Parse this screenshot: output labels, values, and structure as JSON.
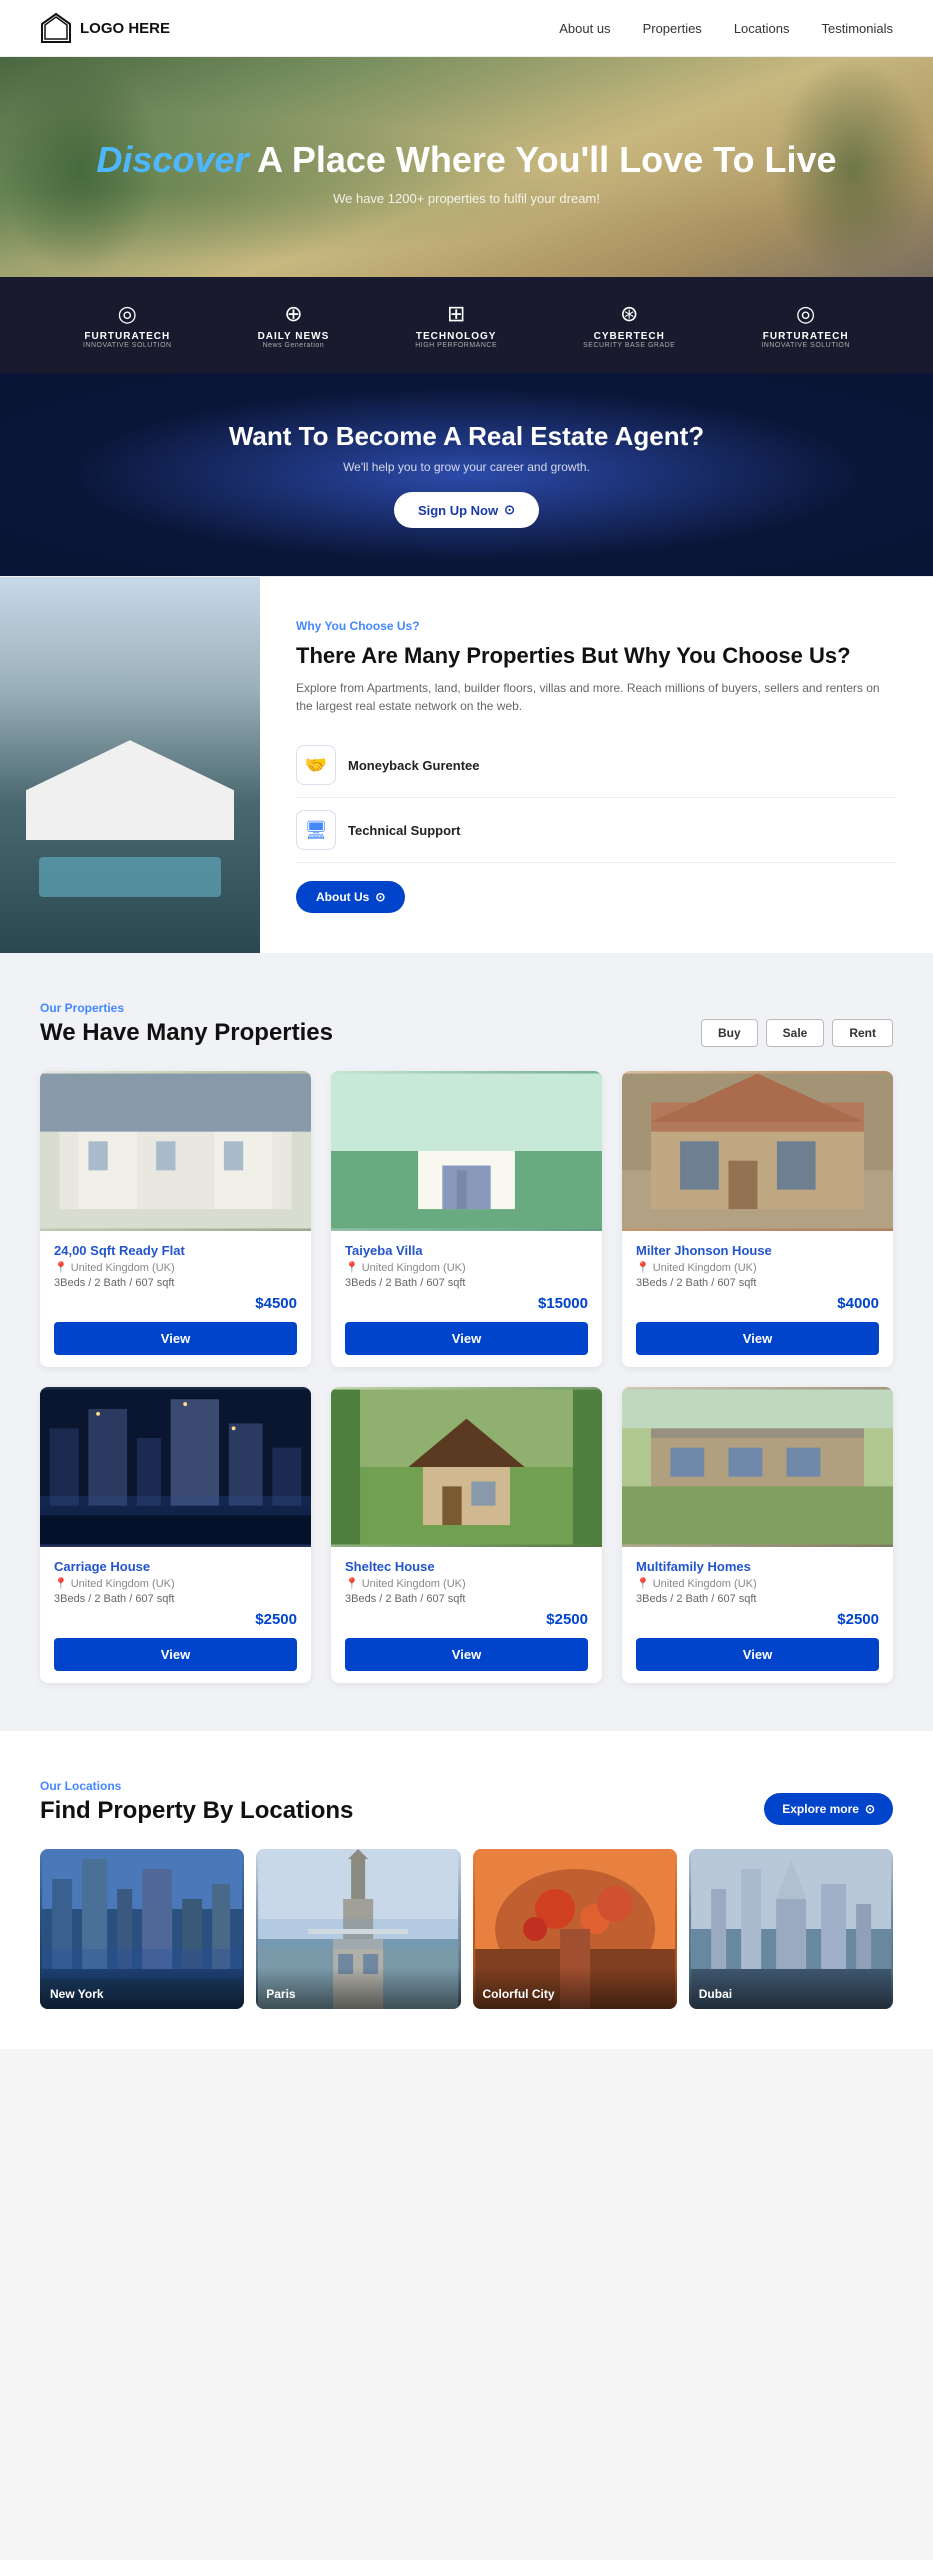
{
  "navbar": {
    "logo_text": "LOGO HERE",
    "links": [
      {
        "label": "About us",
        "id": "about-us"
      },
      {
        "label": "Properties",
        "id": "properties"
      },
      {
        "label": "Locations",
        "id": "locations"
      },
      {
        "label": "Testimonials",
        "id": "testimonials"
      }
    ]
  },
  "hero": {
    "discover": "Discover",
    "title_rest": " A Place Where You'll Love To Live",
    "subtitle": "We have 1200+ properties to fulfil your dream!"
  },
  "brands": [
    {
      "name": "FURTURATECH",
      "tag": "INNOVATIVE SOLUTION",
      "icon": "◎"
    },
    {
      "name": "DAILY NEWS",
      "tag": "News Generation",
      "icon": "⊕"
    },
    {
      "name": "TECHNOLOGY",
      "tag": "HIGH PERFORMANCE",
      "icon": "⊞"
    },
    {
      "name": "CYBERTECH",
      "tag": "SECURITY BASE GRADE",
      "icon": "⊛"
    },
    {
      "name": "FURTURATECH",
      "tag": "INNOVATIVE SOLUTION",
      "icon": "◎"
    }
  ],
  "agent_banner": {
    "title": "Want To Become A Real Estate Agent?",
    "subtitle": "We'll help you to grow your career and growth.",
    "btn_label": "Sign Up Now"
  },
  "why_us": {
    "label": "Why You Choose Us?",
    "title": "There Are Many Properties But Why You Choose Us?",
    "description": "Explore from Apartments, land, builder floors, villas and more. Reach millions of buyers, sellers and renters on the largest real estate network on the web.",
    "features": [
      {
        "icon": "🤝",
        "name": "Moneyback Gurentee",
        "desc": ""
      },
      {
        "icon": "🖥",
        "name": "Technical Support",
        "desc": ""
      }
    ],
    "btn_label": "About Us"
  },
  "properties": {
    "label": "Our Properties",
    "title": "We Have Many Properties",
    "filters": [
      "Buy",
      "Sale",
      "Rent"
    ],
    "items": [
      {
        "name": "24,00 Sqft Ready Flat",
        "location": "United Kingdom (UK)",
        "details": "3Beds / 2 Bath / 607 sqft",
        "price": "$4500",
        "img_class": "img-flat"
      },
      {
        "name": "Taiyeba Villa",
        "location": "United Kingdom (UK)",
        "details": "3Beds / 2 Bath / 607 sqft",
        "price": "$15000",
        "img_class": "img-villa"
      },
      {
        "name": "Milter Jhonson House",
        "location": "United Kingdom (UK)",
        "details": "3Beds / 2 Bath / 607 sqft",
        "price": "$4000",
        "img_class": "img-house-brown"
      },
      {
        "name": "Carriage House",
        "location": "United Kingdom (UK)",
        "details": "3Beds / 2 Bath / 607 sqft",
        "price": "$2500",
        "img_class": "img-city"
      },
      {
        "name": "Sheltec House",
        "location": "United Kingdom (UK)",
        "details": "3Beds / 2 Bath / 607 sqft",
        "price": "$2500",
        "img_class": "img-cottage"
      },
      {
        "name": "Multifamily Homes",
        "location": "United Kingdom (UK)",
        "details": "3Beds / 2 Bath / 607 sqft",
        "price": "$2500",
        "img_class": "img-stone"
      }
    ],
    "view_btn": "View"
  },
  "locations": {
    "label": "Our Locations",
    "title": "Find Property By Locations",
    "explore_btn": "Explore more",
    "items": [
      {
        "name": "New York",
        "img_class": "loc-new-york"
      },
      {
        "name": "Paris",
        "img_class": "loc-paris"
      },
      {
        "name": "Colorful City",
        "img_class": "loc-colorful"
      },
      {
        "name": "Dubai",
        "img_class": "loc-dubai"
      }
    ]
  }
}
